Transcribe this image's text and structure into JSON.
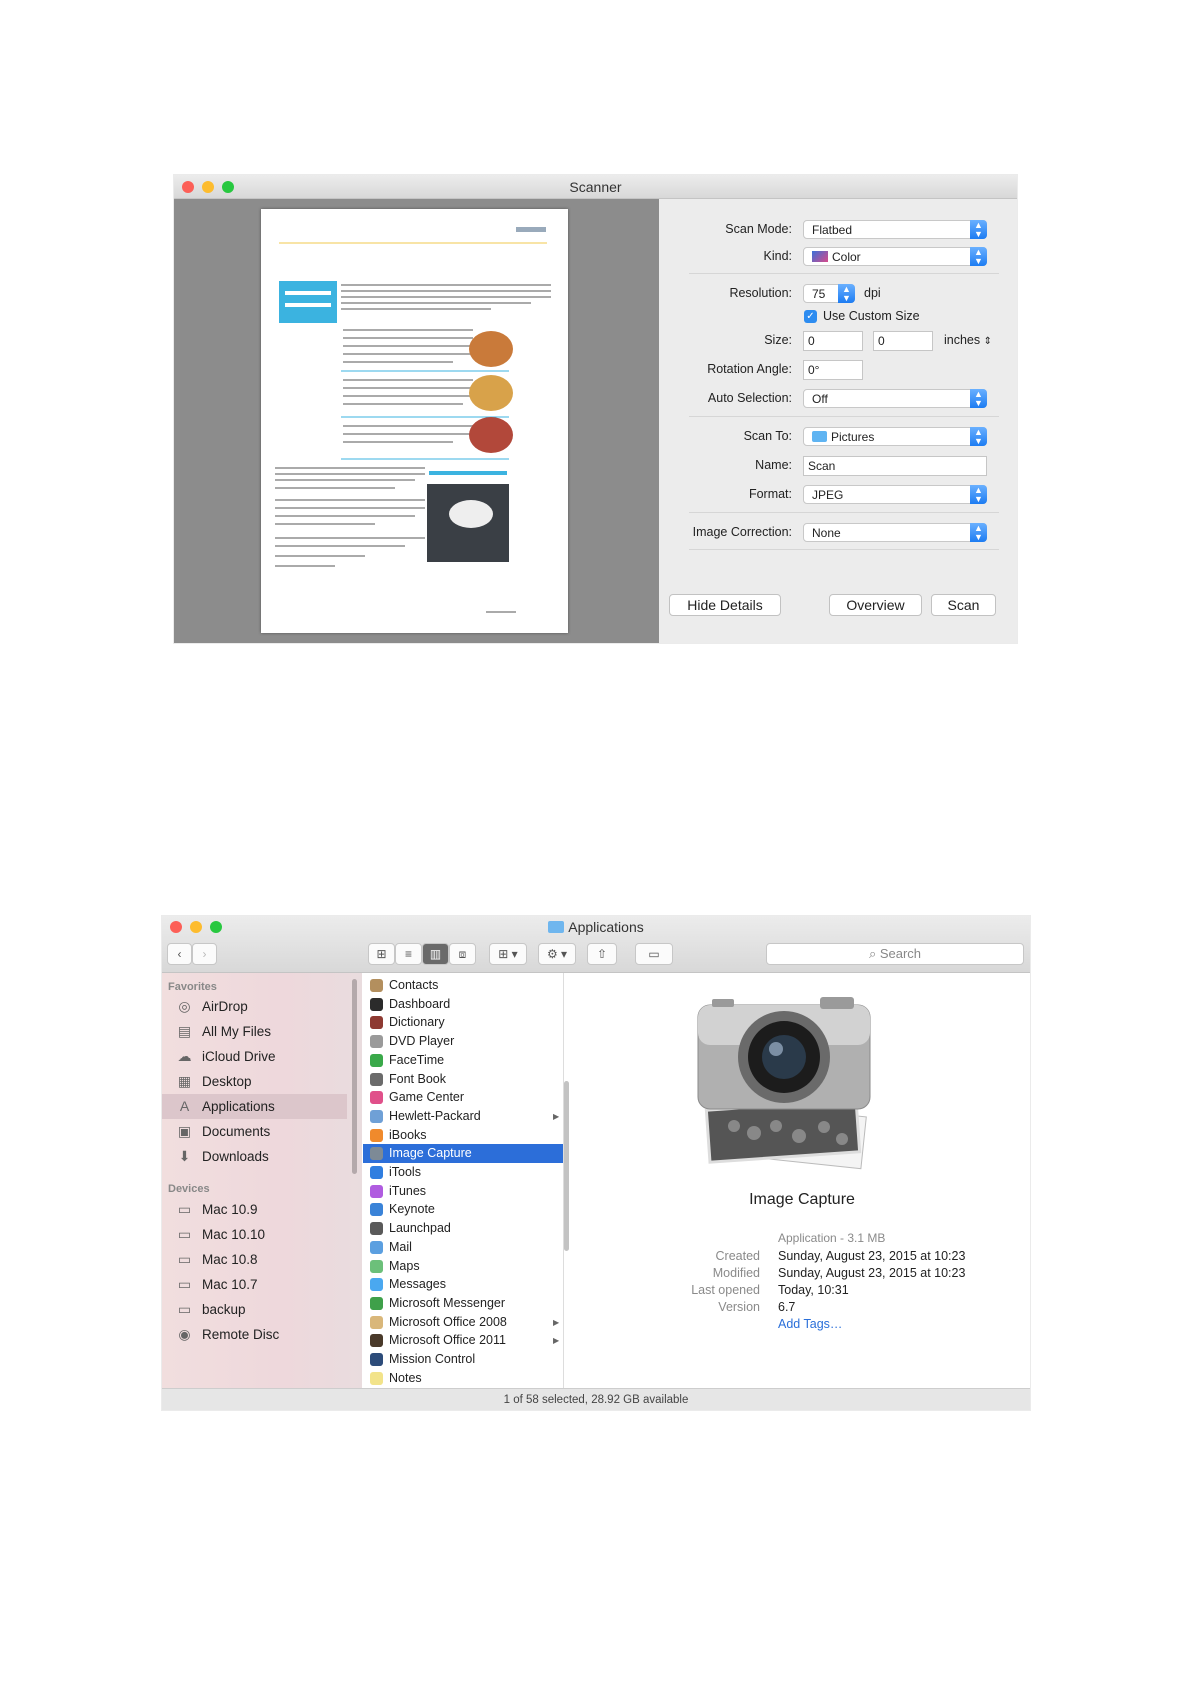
{
  "scanner": {
    "title": "Scanner",
    "rows": {
      "scan_mode": {
        "label": "Scan Mode:",
        "value": "Flatbed"
      },
      "kind": {
        "label": "Kind:",
        "value": "Color"
      },
      "resolution": {
        "label": "Resolution:",
        "value": "75",
        "unit": "dpi"
      },
      "custom_size": {
        "label": "Use Custom Size",
        "checked": true
      },
      "size": {
        "label": "Size:",
        "width": "0",
        "height": "0",
        "unit": "inches"
      },
      "rotation": {
        "label": "Rotation Angle:",
        "value": "0°"
      },
      "auto_selection": {
        "label": "Auto Selection:",
        "value": "Off"
      },
      "scan_to": {
        "label": "Scan To:",
        "value": "Pictures"
      },
      "name": {
        "label": "Name:",
        "value": "Scan"
      },
      "format": {
        "label": "Format:",
        "value": "JPEG"
      },
      "image_correction": {
        "label": "Image Correction:",
        "value": "None"
      }
    },
    "buttons": {
      "hide_details": "Hide Details",
      "overview": "Overview",
      "scan": "Scan"
    }
  },
  "finder": {
    "title": "Applications",
    "search_placeholder": "Search",
    "sidebar": {
      "favorites_heading": "Favorites",
      "favorites": [
        {
          "label": "AirDrop",
          "icon": "airdrop-icon"
        },
        {
          "label": "All My Files",
          "icon": "all-files-icon"
        },
        {
          "label": "iCloud Drive",
          "icon": "cloud-icon"
        },
        {
          "label": "Desktop",
          "icon": "desktop-icon"
        },
        {
          "label": "Applications",
          "icon": "applications-icon",
          "selected": true
        },
        {
          "label": "Documents",
          "icon": "documents-icon"
        },
        {
          "label": "Downloads",
          "icon": "downloads-icon"
        }
      ],
      "devices_heading": "Devices",
      "devices": [
        {
          "label": "Mac 10.9",
          "icon": "disk-icon"
        },
        {
          "label": "Mac 10.10",
          "icon": "disk-icon"
        },
        {
          "label": "Mac 10.8",
          "icon": "disk-icon"
        },
        {
          "label": "Mac 10.7",
          "icon": "disk-icon"
        },
        {
          "label": "backup",
          "icon": "disk-icon"
        },
        {
          "label": "Remote Disc",
          "icon": "remote-disc-icon"
        }
      ]
    },
    "apps": [
      {
        "label": "Contacts",
        "color": "#b38f5e"
      },
      {
        "label": "Dashboard",
        "color": "#2b2b2b"
      },
      {
        "label": "Dictionary",
        "color": "#8e3a32"
      },
      {
        "label": "DVD Player",
        "color": "#9a9a9a"
      },
      {
        "label": "FaceTime",
        "color": "#3aa94a"
      },
      {
        "label": "Font Book",
        "color": "#6b6b6b"
      },
      {
        "label": "Game Center",
        "color": "#e0508a"
      },
      {
        "label": "Hewlett-Packard",
        "color": "#6fa0d6",
        "folder": true
      },
      {
        "label": "iBooks",
        "color": "#f08a2c"
      },
      {
        "label": "Image Capture",
        "color": "#7d8a96",
        "selected": true
      },
      {
        "label": "iTools",
        "color": "#2f7ee0"
      },
      {
        "label": "iTunes",
        "color": "#b05ce0"
      },
      {
        "label": "Keynote",
        "color": "#3a83d8"
      },
      {
        "label": "Launchpad",
        "color": "#5a5a5a"
      },
      {
        "label": "Mail",
        "color": "#5b9fe0"
      },
      {
        "label": "Maps",
        "color": "#6cc07a"
      },
      {
        "label": "Messages",
        "color": "#4aa8f0"
      },
      {
        "label": "Microsoft Messenger",
        "color": "#3fa04a"
      },
      {
        "label": "Microsoft Office 2008",
        "color": "#d9b77a",
        "folder": true
      },
      {
        "label": "Microsoft Office 2011",
        "color": "#4a3a2a",
        "folder": true
      },
      {
        "label": "Mission Control",
        "color": "#2d4c7a"
      },
      {
        "label": "Notes",
        "color": "#f2e38a"
      }
    ],
    "preview": {
      "name": "Image Capture",
      "kind": "Application - 3.1 MB",
      "info": [
        {
          "key": "Created",
          "value": "Sunday, August 23, 2015 at 10:23"
        },
        {
          "key": "Modified",
          "value": "Sunday, August 23, 2015 at 10:23"
        },
        {
          "key": "Last opened",
          "value": "Today, 10:31"
        },
        {
          "key": "Version",
          "value": "6.7"
        }
      ],
      "add_tags": "Add Tags…"
    },
    "status": "1 of 58 selected, 28.92 GB available"
  }
}
